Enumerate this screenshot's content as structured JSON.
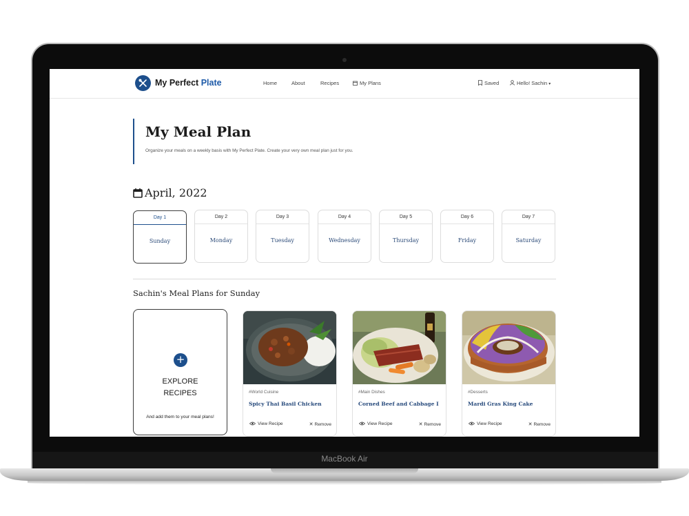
{
  "device": {
    "label": "MacBook Air"
  },
  "nav": {
    "brand_main": "My Perfect ",
    "brand_accent": "Plate",
    "links": [
      "Home",
      "About",
      "Recipes",
      "My Plans"
    ],
    "saved": "Saved",
    "user": "Hello! Sachin"
  },
  "header": {
    "title": "My Meal Plan",
    "subtitle": "Organize your meals on a weekly basis with My Perfect Plate. Create your very own meal plan just for you."
  },
  "calendar": {
    "month": "April, 2022",
    "days": [
      {
        "num": "Day 1",
        "name": "Sunday",
        "active": true
      },
      {
        "num": "Day 2",
        "name": "Monday"
      },
      {
        "num": "Day 3",
        "name": "Tuesday"
      },
      {
        "num": "Day 4",
        "name": "Wednesday"
      },
      {
        "num": "Day 5",
        "name": "Thursday"
      },
      {
        "num": "Day 6",
        "name": "Friday"
      },
      {
        "num": "Day 7",
        "name": "Saturday"
      }
    ]
  },
  "plans": {
    "title": "Sachin's Meal Plans for Sunday",
    "explore": {
      "icon": "plus-icon",
      "title_line1": "EXPLORE",
      "title_line2": "RECIPES",
      "subtitle": "And add them to your meal plans!"
    },
    "recipes": [
      {
        "category": "#World Cuisine",
        "name": "Spicy Thai Basil Chicken",
        "view": "View Recipe",
        "remove": "Remove"
      },
      {
        "category": "#Main Dishes",
        "name": "Corned Beef and Cabbage I",
        "view": "View Recipe",
        "remove": "Remove"
      },
      {
        "category": "#Desserts",
        "name": "Mardi Gras King Cake",
        "view": "View Recipe",
        "remove": "Remove"
      }
    ]
  },
  "colors": {
    "accent": "#1d4f8c",
    "link": "#274a7c"
  }
}
